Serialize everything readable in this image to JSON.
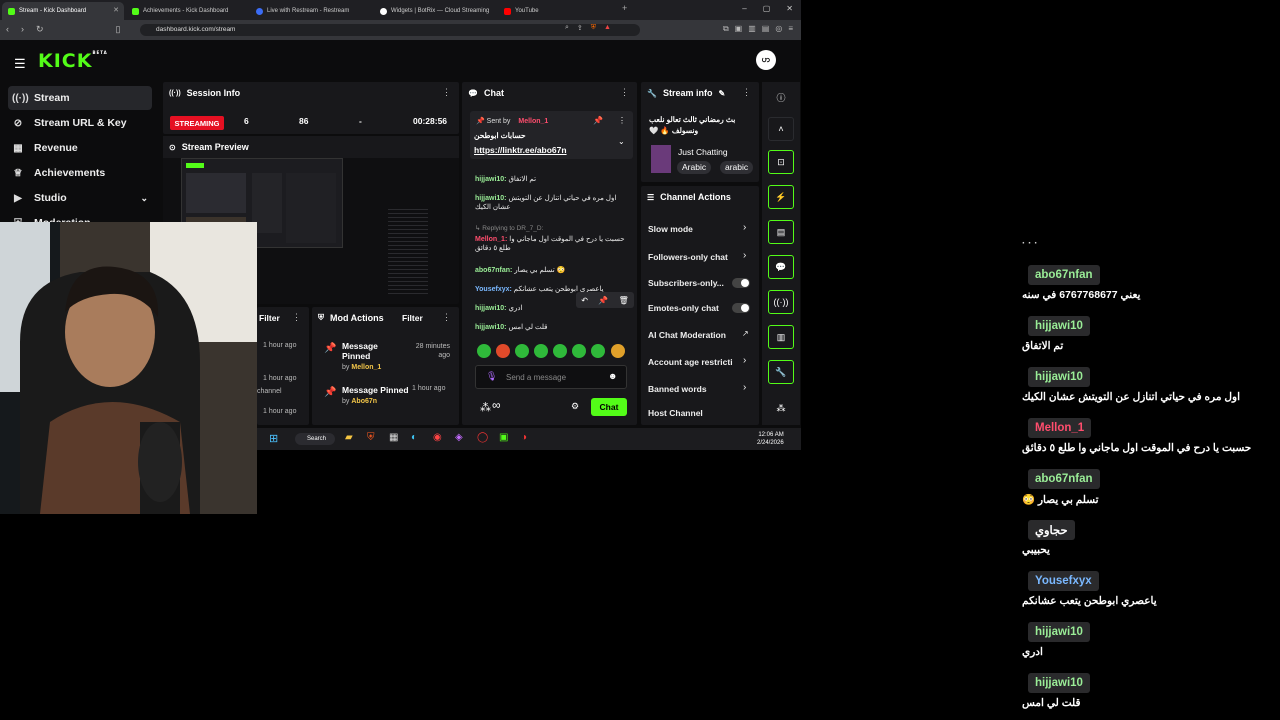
{
  "browser": {
    "tabs": [
      {
        "label": "Stream - Kick Dashboard",
        "favicon_color": "#53fc18"
      },
      {
        "label": "Achievements - Kick Dashboard",
        "favicon_color": "#53fc18"
      },
      {
        "label": "Live with Restream - Restream",
        "favicon_color": "#3b6cf5"
      },
      {
        "label": "Widgets | BotRix — Cloud Streaming",
        "favicon_color": "#ffffff"
      },
      {
        "label": "YouTube",
        "favicon_color": "#ff0000"
      }
    ],
    "url": "dashboard.kick.com/stream"
  },
  "header": {
    "logo": "KICK",
    "logo_sup": "BETA",
    "avatar_text": "ဟ"
  },
  "sidebar": {
    "items": [
      {
        "label": "Stream",
        "icon": "broadcast-icon",
        "glyph": "((·))"
      },
      {
        "label": "Stream URL & Key",
        "icon": "link-icon",
        "glyph": "🔗"
      },
      {
        "label": "Revenue",
        "icon": "chart-icon",
        "glyph": "▦"
      },
      {
        "label": "Achievements",
        "icon": "trophy-icon",
        "glyph": "🏆"
      },
      {
        "label": "Studio",
        "icon": "video-icon",
        "glyph": "▶"
      },
      {
        "label": "Moderation",
        "icon": "shield-icon",
        "glyph": "⛨"
      }
    ]
  },
  "session": {
    "title": "Session Info",
    "badge": "STREAMING",
    "viewers": "6",
    "followers": "86",
    "dash": "-",
    "duration": "00:28:56",
    "preview_title": "Stream Preview"
  },
  "mod_actions": {
    "title": "Mod Actions",
    "filter": "Filter",
    "left_filter": "Filter",
    "left_times": [
      "1 hour ago",
      "1 hour ago",
      "1 hour ago"
    ],
    "left_fragment": "channel",
    "items": [
      {
        "action": "Message Pinned",
        "by": "by",
        "user": "Mellon_1",
        "time": "28 minutes ago"
      },
      {
        "action": "Message Pinned",
        "by": "by",
        "user": "Abo67n",
        "time": "1 hour ago"
      }
    ]
  },
  "chat": {
    "title": "Chat",
    "pinned_label": "Sent by",
    "pinned_user": "Mellon_1",
    "pinned_text": "حسابات ابوطحن",
    "pinned_link": "https://linktr.ee/abo67n",
    "messages": [
      {
        "user": "hijjawi10:",
        "text": "تم الاتفاق",
        "color": "green"
      },
      {
        "user": "hijjawi10:",
        "text": "اول مره في حياتي اتنازل عن التويتش عشان الكيك",
        "color": "green"
      },
      {
        "reply": "Replying to DR_7_D:",
        "user": "Mellon_1:",
        "text": "حسبت يا درح في الموقت اول ماجاني وا طلع ٥ دقائق",
        "color": "red"
      },
      {
        "user": "abo67nfan:",
        "text": "تسلم بي يصار 😳",
        "color": "green"
      },
      {
        "user": "Yousefxyx:",
        "text": "ياعصري ابوطحن يتعب عشانكم",
        "color": "blue"
      },
      {
        "user": "hijjawi10:",
        "text": "ادري",
        "color": "green"
      },
      {
        "user": "hijjawi10:",
        "text": "قلت لي امس",
        "color": "green"
      }
    ],
    "input_placeholder": "Send a message",
    "send_label": "Chat",
    "infinity": "∞"
  },
  "stream_info": {
    "title": "Stream info",
    "stream_title": "بث رمضاني ثالث تعالو نلعب ونسولف 🔥 🤍",
    "category": "Just Chatting",
    "tags": [
      "Arabic",
      "arabic"
    ]
  },
  "channel_actions": {
    "title": "Channel Actions",
    "items": [
      {
        "label": "Slow mode",
        "control": "chevron"
      },
      {
        "label": "Followers-only chat",
        "control": "chevron"
      },
      {
        "label": "Subscribers-only...",
        "control": "toggle"
      },
      {
        "label": "Emotes-only chat",
        "control": "toggle"
      },
      {
        "label": "AI Chat Moderation",
        "control": "external"
      },
      {
        "label": "Account age restricti",
        "control": "chevron"
      },
      {
        "label": "Banned words",
        "control": "chevron"
      },
      {
        "label": "Host Channel",
        "control": "none"
      }
    ]
  },
  "taskbar": {
    "search": "Search",
    "time": "12:06 AM",
    "date": "2/24/2026"
  },
  "overlay_chat": [
    {
      "user": "abo67nfan",
      "text": "يعني 6767768677 في سنه",
      "color": "#9aed97"
    },
    {
      "user": "hijjawi10",
      "text": "تم الاتفاق",
      "color": "#9aed97"
    },
    {
      "user": "hijjawi10",
      "text": "اول مره في حياتي اتنازل عن التويتش عشان الكيك",
      "color": "#9aed97"
    },
    {
      "user": "Mellon_1",
      "text": "حسبت يا درح في الموقت اول ماجاني وا طلع ٥ دقائق",
      "color": "#ff4d6d"
    },
    {
      "user": "abo67nfan",
      "text": "تسلم بي يصار 😳",
      "color": "#9aed97"
    },
    {
      "user": "حجاوي",
      "text": "يحبيبي",
      "color": "#ffffff"
    },
    {
      "user": "Yousefxyx",
      "text": "ياعصري ابوطحن يتعب عشانكم",
      "color": "#7ab8ff"
    },
    {
      "user": "hijjawi10",
      "text": "ادري",
      "color": "#9aed97"
    },
    {
      "user": "hijjawi10",
      "text": "قلت لي امس",
      "color": "#9aed97"
    }
  ],
  "colors": {
    "accent": "#53fc18",
    "live": "#e51022",
    "panel": "#18181b"
  }
}
